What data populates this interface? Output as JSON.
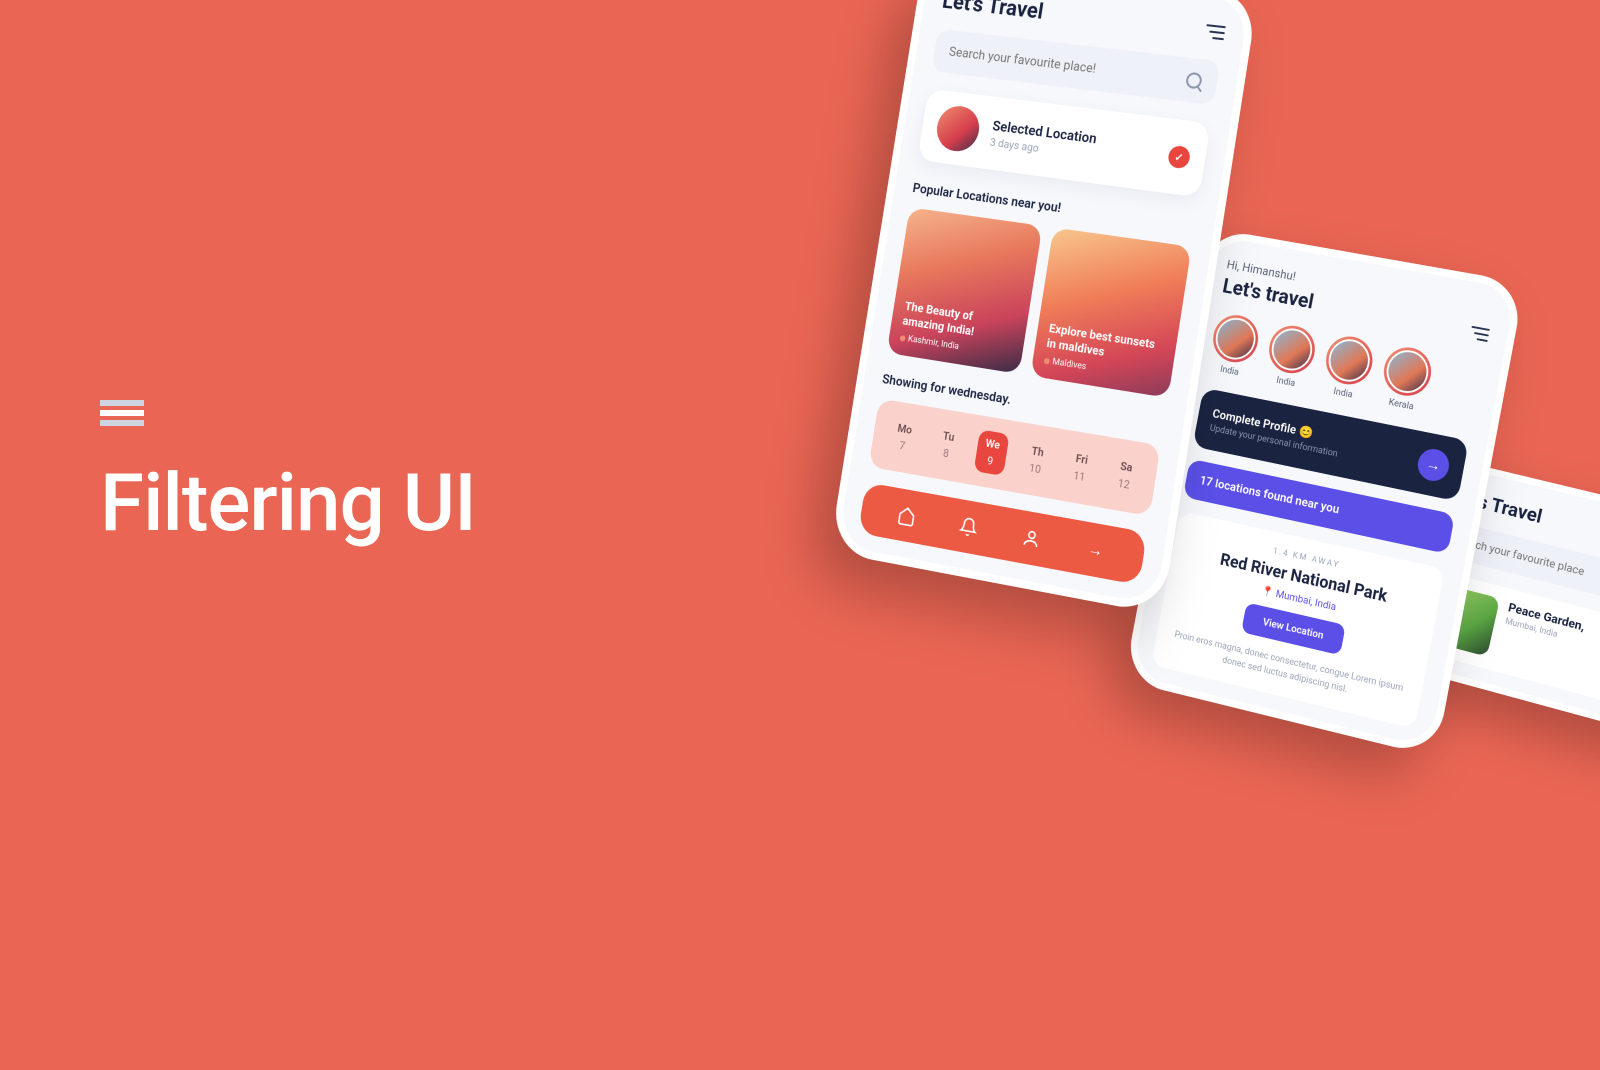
{
  "hero": {
    "title": "Filtering UI"
  },
  "phone1": {
    "title": "Let's Travel",
    "search_placeholder": "Search your favourite place!",
    "selected": {
      "title": "Selected Location",
      "sub": "3 days ago"
    },
    "popular_heading": "Popular Locations near you!",
    "popular": [
      {
        "title": "The Beauty of amazing India!",
        "location": "Kashmir, India"
      },
      {
        "title": "Explore best sunsets in maldives",
        "location": "Maldives"
      }
    ],
    "showing": "Showing for wednesday.",
    "days": [
      {
        "label": "Mo",
        "num": "7",
        "active": false
      },
      {
        "label": "Tu",
        "num": "8",
        "active": false
      },
      {
        "label": "We",
        "num": "9",
        "active": true
      },
      {
        "label": "Th",
        "num": "10",
        "active": false
      },
      {
        "label": "Fri",
        "num": "11",
        "active": false
      },
      {
        "label": "Sa",
        "num": "12",
        "active": false
      }
    ]
  },
  "phone2": {
    "greeting": "Hi, Himanshu!",
    "title": "Let's travel",
    "stories": [
      "India",
      "India",
      "India",
      "Kerala"
    ],
    "profile": {
      "title": "Complete Profile 😊",
      "sub": "Update your personal information"
    },
    "found": "17 locations found near you",
    "distance": "1.4 KM AWAY",
    "location_name": "Red River National Park",
    "location_place": "Mumbai, India",
    "view_button": "View Location",
    "lorem": "Proin eros magna, donec consectetur, congue Lorem ipsum donec sed luctus adipiscing nisl."
  },
  "phone3": {
    "title": "Let's Travel",
    "search_placeholder": "Search your favourite place",
    "card": {
      "title": "Peace Garden,",
      "location": "Mumbai, India"
    }
  }
}
